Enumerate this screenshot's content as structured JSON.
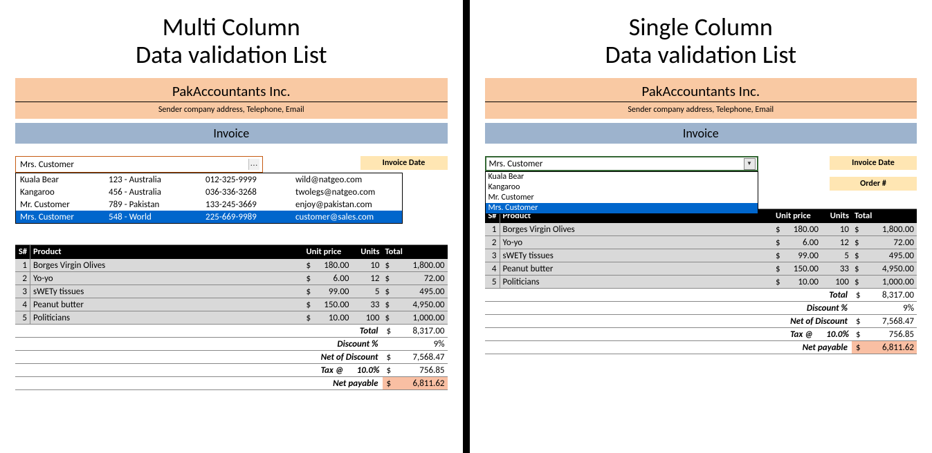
{
  "left": {
    "big_title_1": "Multi Column",
    "big_title_2": "Data validation List",
    "company_name": "PakAccountants Inc.",
    "company_sub": "Sender company address, Telephone, Email",
    "invoice_label": "Invoice",
    "combo_value": "Mrs. Customer",
    "ellipsis": "...",
    "dropdown": [
      {
        "name": "Kuala Bear",
        "addr": "123 - Australia",
        "phone": "012-325-9999",
        "email": "wild@natgeo.com",
        "selected": false
      },
      {
        "name": "Kangaroo",
        "addr": "456 - Australia",
        "phone": "036-336-3268",
        "email": "twolegs@natgeo.com",
        "selected": false
      },
      {
        "name": "Mr. Customer",
        "addr": "789 - Pakistan",
        "phone": "133-245-3669",
        "email": "enjoy@pakistan.com",
        "selected": false
      },
      {
        "name": "Mrs. Customer",
        "addr": "548 - World",
        "phone": "225-669-9989",
        "email": "customer@sales.com",
        "selected": true
      }
    ],
    "side_labels": [
      "Invoice Date"
    ],
    "grid_headers": {
      "sn": "S#",
      "product": "Product",
      "unit_price": "Unit price",
      "units": "Units",
      "total": "Total"
    },
    "rows": [
      {
        "sn": "1",
        "product": "Borges Virgin Olives",
        "up": "180.00",
        "units": "10",
        "tot": "1,800.00"
      },
      {
        "sn": "2",
        "product": "Yo-yo",
        "up": "6.00",
        "units": "12",
        "tot": "72.00"
      },
      {
        "sn": "3",
        "product": "sWETy tissues",
        "up": "99.00",
        "units": "5",
        "tot": "495.00"
      },
      {
        "sn": "4",
        "product": "Peanut butter",
        "up": "150.00",
        "units": "33",
        "tot": "4,950.00"
      },
      {
        "sn": "5",
        "product": "Politicians",
        "up": "10.00",
        "units": "100",
        "tot": "1,000.00"
      }
    ],
    "summary": {
      "currency": "$",
      "total_label": "Total",
      "total": "8,317.00",
      "discount_label": "Discount %",
      "discount": "9%",
      "net_discount_label": "Net of Discount",
      "net_discount": "7,568.47",
      "tax_label": "Tax @",
      "tax_rate": "10.0%",
      "tax": "756.85",
      "net_payable_label": "Net payable",
      "net_payable": "6,811.62"
    }
  },
  "right": {
    "big_title_1": "Single Column",
    "big_title_2": "Data validation List",
    "company_name": "PakAccountants Inc.",
    "company_sub": "Sender company address, Telephone, Email",
    "invoice_label": "Invoice",
    "combo_value": "Mrs. Customer",
    "dropdown": [
      {
        "name": "Kuala Bear",
        "selected": false
      },
      {
        "name": "Kangaroo",
        "selected": false
      },
      {
        "name": "Mr. Customer",
        "selected": false
      },
      {
        "name": "Mrs. Customer",
        "selected": true
      }
    ],
    "side_labels": [
      "Invoice Date",
      "Order #"
    ],
    "grid_headers": {
      "sn": "S#",
      "product": "Product",
      "unit_price": "Unit price",
      "units": "Units",
      "total": "Total"
    },
    "rows": [
      {
        "sn": "1",
        "product": "Borges Virgin Olives",
        "up": "180.00",
        "units": "10",
        "tot": "1,800.00"
      },
      {
        "sn": "2",
        "product": "Yo-yo",
        "up": "6.00",
        "units": "12",
        "tot": "72.00"
      },
      {
        "sn": "3",
        "product": "sWETy tissues",
        "up": "99.00",
        "units": "5",
        "tot": "495.00"
      },
      {
        "sn": "4",
        "product": "Peanut butter",
        "up": "150.00",
        "units": "33",
        "tot": "4,950.00"
      },
      {
        "sn": "5",
        "product": "Politicians",
        "up": "10.00",
        "units": "100",
        "tot": "1,000.00"
      }
    ],
    "summary": {
      "currency": "$",
      "total_label": "Total",
      "total": "8,317.00",
      "discount_label": "Discount %",
      "discount": "9%",
      "net_discount_label": "Net of Discount",
      "net_discount": "7,568.47",
      "tax_label": "Tax @",
      "tax_rate": "10.0%",
      "tax": "756.85",
      "net_payable_label": "Net payable",
      "net_payable": "6,811.62"
    }
  }
}
